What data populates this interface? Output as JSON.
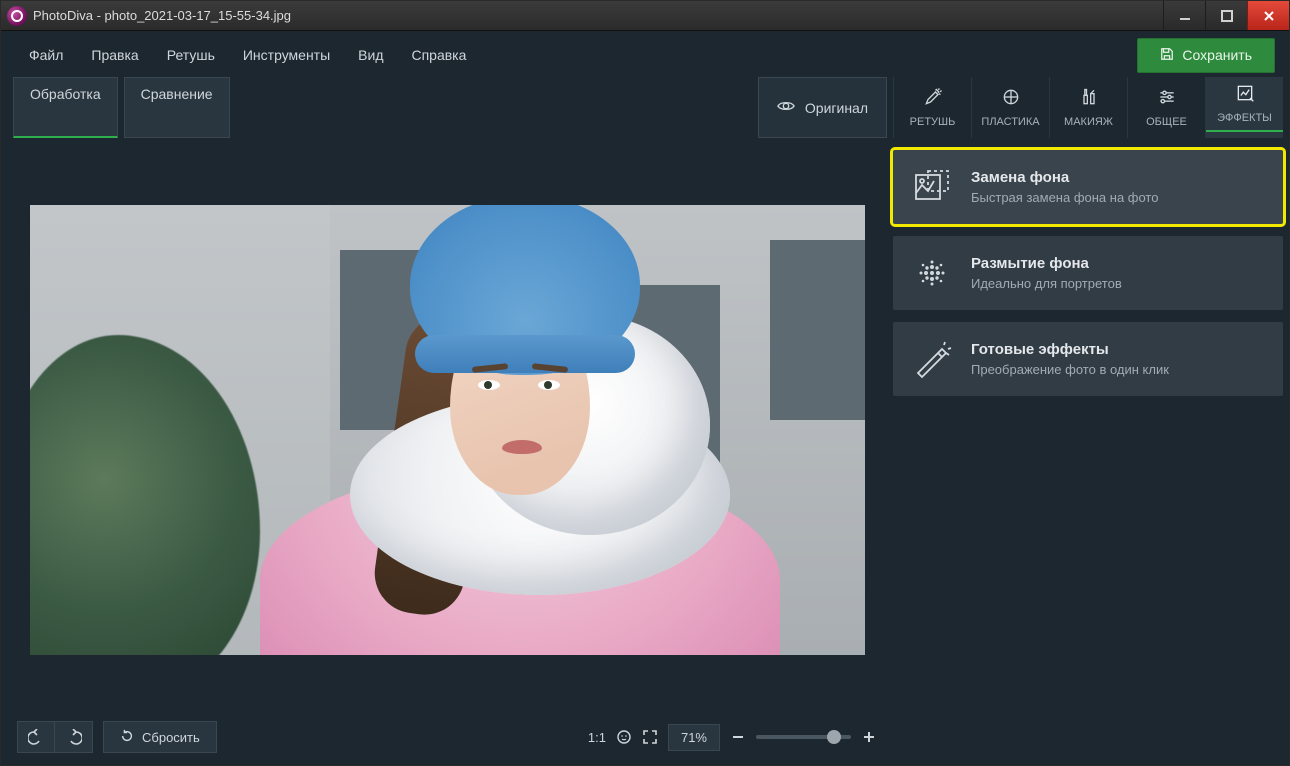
{
  "window": {
    "title": "PhotoDiva - photo_2021-03-17_15-55-34.jpg"
  },
  "menu": {
    "file": "Файл",
    "edit": "Правка",
    "retouch": "Ретушь",
    "tools": "Инструменты",
    "view": "Вид",
    "help": "Справка"
  },
  "save_button": "Сохранить",
  "viewtabs": {
    "processing": "Обработка",
    "compare": "Сравнение"
  },
  "original_button": "Оригинал",
  "tooltabs": {
    "retouch": "РЕТУШЬ",
    "plastic": "ПЛАСТИКА",
    "makeup": "МАКИЯЖ",
    "general": "ОБЩЕЕ",
    "effects": "ЭФФЕКТЫ"
  },
  "effects": [
    {
      "title": "Замена фона",
      "subtitle": "Быстрая замена фона на фото",
      "selected": true,
      "icon": "replace-bg"
    },
    {
      "title": "Размытие фона",
      "subtitle": "Идеально для портретов",
      "selected": false,
      "icon": "blur-bg"
    },
    {
      "title": "Готовые эффекты",
      "subtitle": "Преображение фото в один клик",
      "selected": false,
      "icon": "presets"
    }
  ],
  "bottom": {
    "reset": "Сбросить",
    "ratio": "1:1",
    "zoom": "71%"
  }
}
